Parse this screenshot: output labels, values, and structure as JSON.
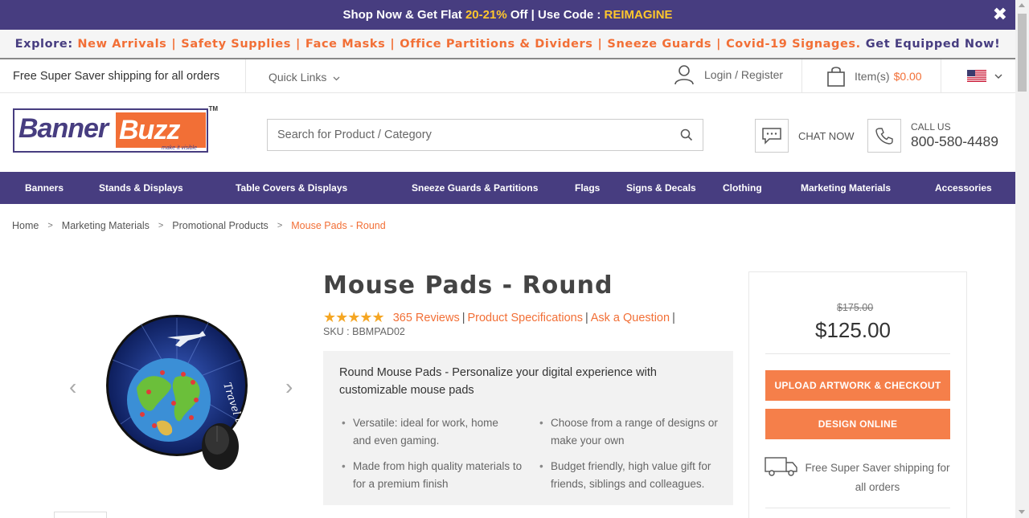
{
  "promo": {
    "prefix": "Shop Now & Get Flat ",
    "highlight": "20-21%",
    "middle": " Off | Use Code : ",
    "code": "REIMAGINE",
    "close": "✖"
  },
  "explore": {
    "lead": "Explore:",
    "links": [
      "New Arrivals",
      "Safety Supplies",
      "Face Masks",
      "Office Partitions & Dividers",
      "Sneeze Guards",
      "Covid-19 Signages"
    ],
    "sep": "|",
    "dot": ".",
    "tail": "Get Equipped Now!"
  },
  "util": {
    "shipping": "Free Super Saver shipping for all orders",
    "quick_links": "Quick Links",
    "login": "Login / Register",
    "cart_label": "Item(s)",
    "cart_amount": "$0.00"
  },
  "header": {
    "logo_part1": "Banner",
    "logo_part2": "Buzz",
    "logo_tagline": "make it visible",
    "logo_tm": "TM",
    "search_placeholder": "Search for Product / Category",
    "chat": "CHAT NOW",
    "call_label": "CALL US",
    "call_number": "800-580-4489"
  },
  "nav": [
    "Banners",
    "Stands & Displays",
    "Table Covers & Displays",
    "Sneeze Guards & Partitions",
    "Flags",
    "Signs & Decals",
    "Clothing",
    "Marketing Materials",
    "Accessories"
  ],
  "breadcrumb": {
    "items": [
      "Home",
      "Marketing Materials",
      "Promotional Products"
    ],
    "current": "Mouse Pads - Round",
    "arrow": ">"
  },
  "product": {
    "title": "Mouse Pads - Round",
    "rating": 4.5,
    "stars": "★★★★★",
    "reviews": "365 Reviews",
    "specs": "Product Specifications",
    "ask": "Ask a Question",
    "bar": "|",
    "sku": "SKU : BBMPAD02",
    "image_text": "Travel the world!",
    "desc_head": "Round Mouse Pads - Personalize your digital experience with customizable mouse pads",
    "features": [
      "Versatile: ideal for work, home and even gaming.",
      "Choose from a range of designs or make your own",
      "Made from high quality materials to for a premium finish",
      "Budget friendly, high value gift for friends, siblings and colleagues."
    ]
  },
  "pricing": {
    "old_price": "$175.00",
    "price": "$125.00",
    "upload_btn": "UPLOAD ARTWORK & CHECKOUT",
    "design_btn": "DESIGN ONLINE",
    "shipping_note": "Free Super Saver shipping for all orders"
  },
  "colors": {
    "brand_purple": "#473d80",
    "brand_orange": "#f26f36",
    "button_orange": "#f57f4a",
    "promo_yellow": "#ffc72c",
    "star_gold": "#f5a623"
  }
}
